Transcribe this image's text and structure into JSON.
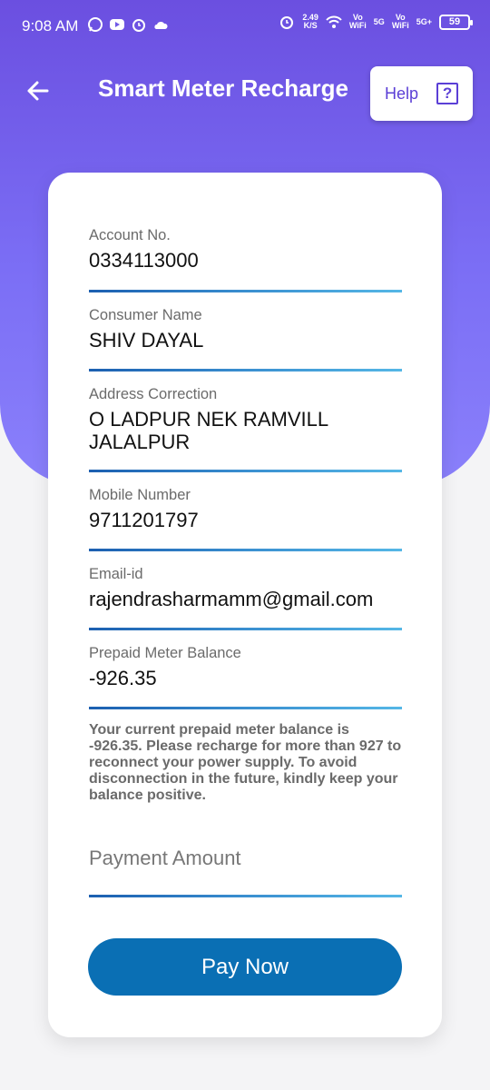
{
  "status_bar": {
    "time": "9:08 AM",
    "speed_value": "2.49",
    "speed_unit": "K/S",
    "net1": "Vo\nWiFi",
    "net1_type": "5G",
    "net2": "Vo\nWiFi",
    "net2_type": "5G+",
    "battery": "59"
  },
  "header": {
    "title": "Smart Meter Recharge",
    "help_label": "Help",
    "help_icon_glyph": "?",
    "bg_color_top": "#6b4fe0",
    "bg_color_bottom": "#8a80fb"
  },
  "fields": [
    {
      "label": "Account No.",
      "value": "0334113000"
    },
    {
      "label": "Consumer Name",
      "value": "SHIV DAYAL"
    },
    {
      "label": "Address Correction",
      "value": "O LADPUR NEK RAMVILL JALALPUR"
    },
    {
      "label": "Mobile Number",
      "value": "9711201797"
    },
    {
      "label": "Email-id",
      "value": "rajendrasharmamm@gmail.com"
    },
    {
      "label": "Prepaid Meter Balance",
      "value": "-926.35"
    }
  ],
  "notice": "Your current prepaid meter balance is -926.35. Please recharge for more than 927 to reconnect your power supply. To avoid disconnection in the future, kindly keep your balance positive.",
  "payment": {
    "placeholder": "Payment Amount",
    "value": ""
  },
  "pay_button_label": "Pay Now",
  "accent_color": "#0a6fb4"
}
